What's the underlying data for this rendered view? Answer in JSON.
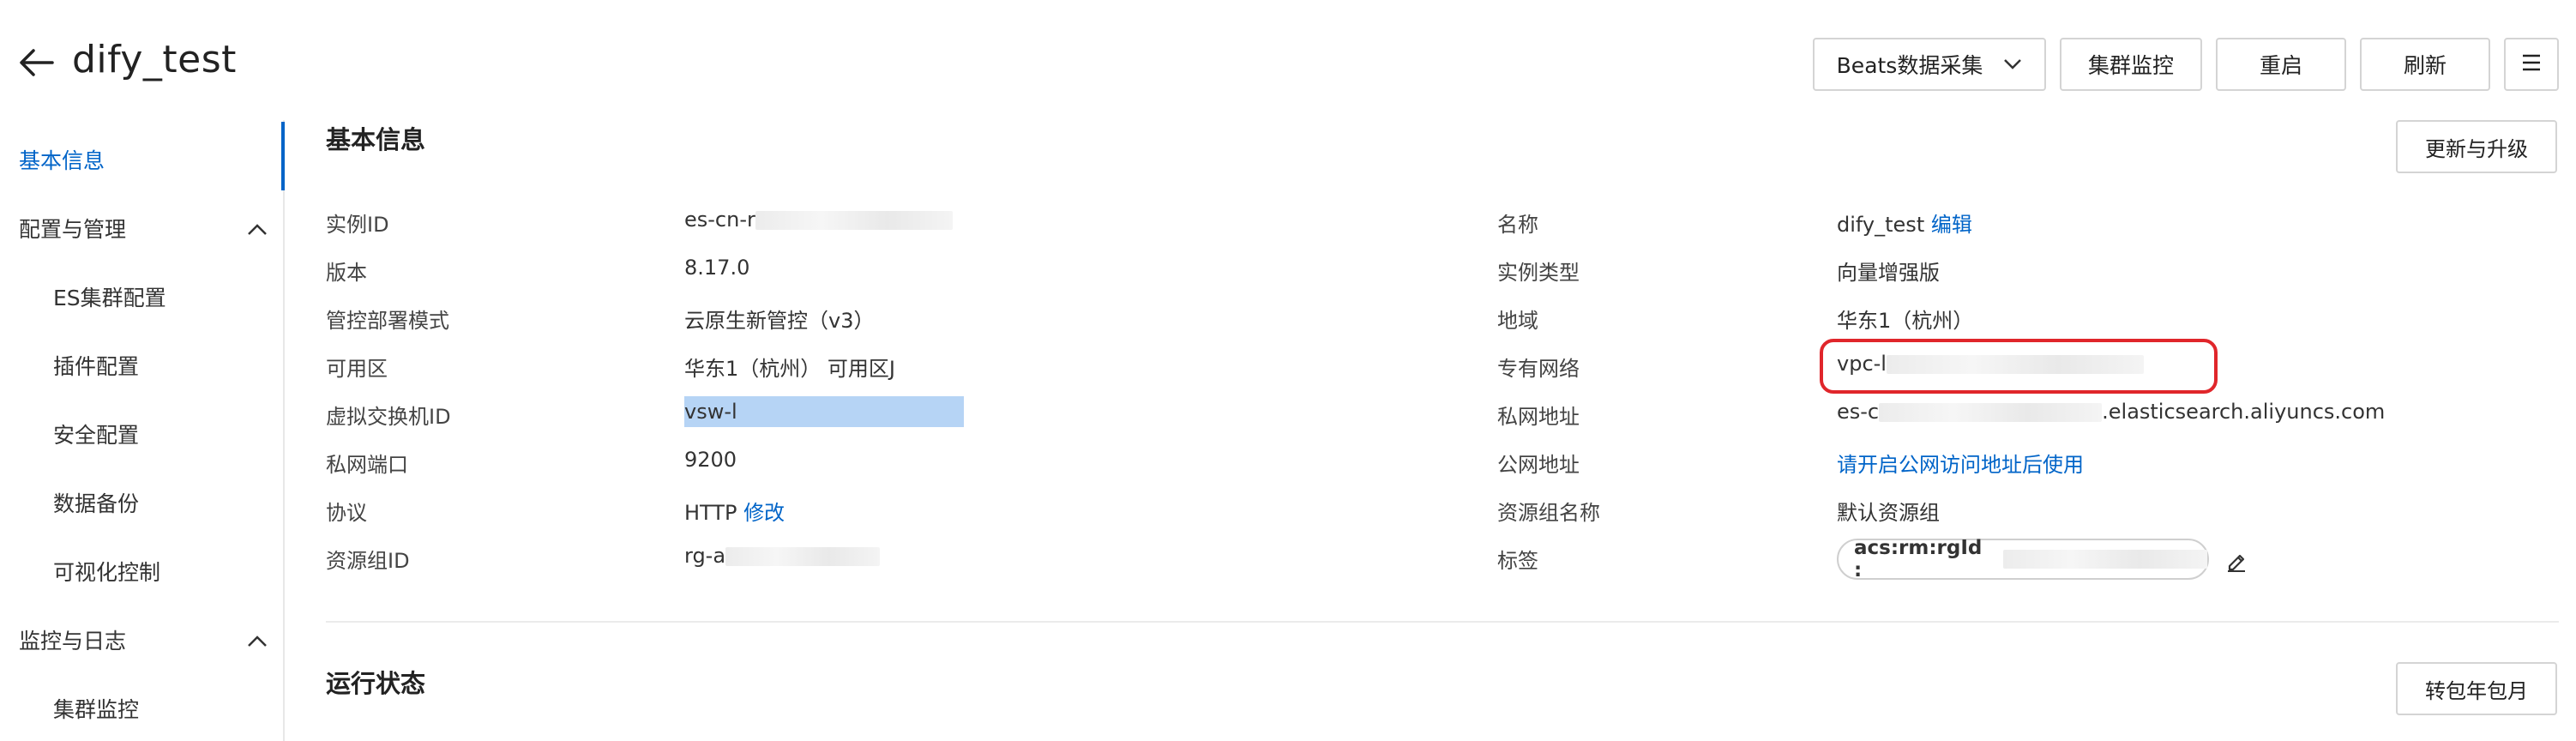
{
  "header": {
    "title": "dify_test",
    "buttons": {
      "beats": "Beats数据采集",
      "cluster_monitor": "集群监控",
      "restart": "重启",
      "refresh": "刷新"
    }
  },
  "sidebar": {
    "basic_info": "基本信息",
    "config_group": "配置与管理",
    "config_items": [
      "ES集群配置",
      "插件配置",
      "安全配置",
      "数据备份",
      "可视化控制"
    ],
    "monitor_group": "监控与日志",
    "monitor_items": [
      "集群监控"
    ]
  },
  "basic": {
    "title": "基本信息",
    "upgrade_button": "更新与升级",
    "left": {
      "instance_id_label": "实例ID",
      "instance_id_value": "es-cn-r",
      "version_label": "版本",
      "version_value": "8.17.0",
      "deploy_mode_label": "管控部署模式",
      "deploy_mode_value": "云原生新管控（v3）",
      "zone_label": "可用区",
      "zone_value": "华东1（杭州） 可用区J",
      "vswitch_label": "虚拟交换机ID",
      "vswitch_value": "vsw-l",
      "private_port_label": "私网端口",
      "private_port_value": "9200",
      "protocol_label": "协议",
      "protocol_value": "HTTP",
      "protocol_edit": "修改",
      "resource_group_id_label": "资源组ID",
      "resource_group_id_value": "rg-a"
    },
    "right": {
      "name_label": "名称",
      "name_value": "dify_test",
      "name_edit": "编辑",
      "instance_type_label": "实例类型",
      "instance_type_value": "向量增强版",
      "region_label": "地域",
      "region_value": "华东1（杭州）",
      "vpc_label": "专有网络",
      "vpc_value": "vpc-l",
      "private_addr_label": "私网地址",
      "private_addr_prefix": "es-c",
      "private_addr_suffix": ".elasticsearch.aliyuncs.com",
      "public_addr_label": "公网地址",
      "public_addr_value": "请开启公网访问地址后使用",
      "resource_group_name_label": "资源组名称",
      "resource_group_name_value": "默认资源组",
      "tag_label": "标签",
      "tag_value": "acs:rm:rgId :"
    }
  },
  "running": {
    "title": "运行状态",
    "convert_button": "转包年包月"
  },
  "colors": {
    "accent": "#0064c8",
    "highlight": "#e0262b",
    "selection": "#b6d4f5"
  }
}
